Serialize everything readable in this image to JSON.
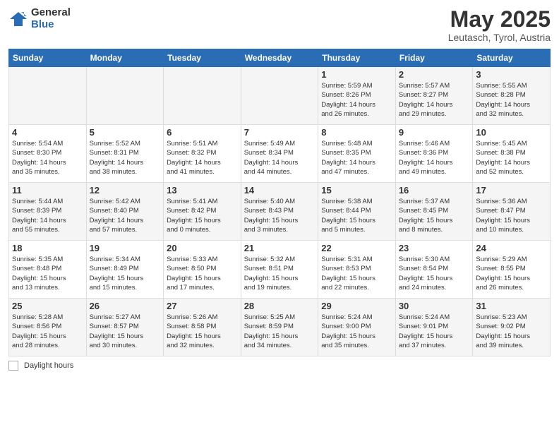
{
  "logo": {
    "general": "General",
    "blue": "Blue"
  },
  "title": "May 2025",
  "subtitle": "Leutasch, Tyrol, Austria",
  "days_header": [
    "Sunday",
    "Monday",
    "Tuesday",
    "Wednesday",
    "Thursday",
    "Friday",
    "Saturday"
  ],
  "weeks": [
    [
      {
        "num": "",
        "info": ""
      },
      {
        "num": "",
        "info": ""
      },
      {
        "num": "",
        "info": ""
      },
      {
        "num": "",
        "info": ""
      },
      {
        "num": "1",
        "info": "Sunrise: 5:59 AM\nSunset: 8:26 PM\nDaylight: 14 hours\nand 26 minutes."
      },
      {
        "num": "2",
        "info": "Sunrise: 5:57 AM\nSunset: 8:27 PM\nDaylight: 14 hours\nand 29 minutes."
      },
      {
        "num": "3",
        "info": "Sunrise: 5:55 AM\nSunset: 8:28 PM\nDaylight: 14 hours\nand 32 minutes."
      }
    ],
    [
      {
        "num": "4",
        "info": "Sunrise: 5:54 AM\nSunset: 8:30 PM\nDaylight: 14 hours\nand 35 minutes."
      },
      {
        "num": "5",
        "info": "Sunrise: 5:52 AM\nSunset: 8:31 PM\nDaylight: 14 hours\nand 38 minutes."
      },
      {
        "num": "6",
        "info": "Sunrise: 5:51 AM\nSunset: 8:32 PM\nDaylight: 14 hours\nand 41 minutes."
      },
      {
        "num": "7",
        "info": "Sunrise: 5:49 AM\nSunset: 8:34 PM\nDaylight: 14 hours\nand 44 minutes."
      },
      {
        "num": "8",
        "info": "Sunrise: 5:48 AM\nSunset: 8:35 PM\nDaylight: 14 hours\nand 47 minutes."
      },
      {
        "num": "9",
        "info": "Sunrise: 5:46 AM\nSunset: 8:36 PM\nDaylight: 14 hours\nand 49 minutes."
      },
      {
        "num": "10",
        "info": "Sunrise: 5:45 AM\nSunset: 8:38 PM\nDaylight: 14 hours\nand 52 minutes."
      }
    ],
    [
      {
        "num": "11",
        "info": "Sunrise: 5:44 AM\nSunset: 8:39 PM\nDaylight: 14 hours\nand 55 minutes."
      },
      {
        "num": "12",
        "info": "Sunrise: 5:42 AM\nSunset: 8:40 PM\nDaylight: 14 hours\nand 57 minutes."
      },
      {
        "num": "13",
        "info": "Sunrise: 5:41 AM\nSunset: 8:42 PM\nDaylight: 15 hours\nand 0 minutes."
      },
      {
        "num": "14",
        "info": "Sunrise: 5:40 AM\nSunset: 8:43 PM\nDaylight: 15 hours\nand 3 minutes."
      },
      {
        "num": "15",
        "info": "Sunrise: 5:38 AM\nSunset: 8:44 PM\nDaylight: 15 hours\nand 5 minutes."
      },
      {
        "num": "16",
        "info": "Sunrise: 5:37 AM\nSunset: 8:45 PM\nDaylight: 15 hours\nand 8 minutes."
      },
      {
        "num": "17",
        "info": "Sunrise: 5:36 AM\nSunset: 8:47 PM\nDaylight: 15 hours\nand 10 minutes."
      }
    ],
    [
      {
        "num": "18",
        "info": "Sunrise: 5:35 AM\nSunset: 8:48 PM\nDaylight: 15 hours\nand 13 minutes."
      },
      {
        "num": "19",
        "info": "Sunrise: 5:34 AM\nSunset: 8:49 PM\nDaylight: 15 hours\nand 15 minutes."
      },
      {
        "num": "20",
        "info": "Sunrise: 5:33 AM\nSunset: 8:50 PM\nDaylight: 15 hours\nand 17 minutes."
      },
      {
        "num": "21",
        "info": "Sunrise: 5:32 AM\nSunset: 8:51 PM\nDaylight: 15 hours\nand 19 minutes."
      },
      {
        "num": "22",
        "info": "Sunrise: 5:31 AM\nSunset: 8:53 PM\nDaylight: 15 hours\nand 22 minutes."
      },
      {
        "num": "23",
        "info": "Sunrise: 5:30 AM\nSunset: 8:54 PM\nDaylight: 15 hours\nand 24 minutes."
      },
      {
        "num": "24",
        "info": "Sunrise: 5:29 AM\nSunset: 8:55 PM\nDaylight: 15 hours\nand 26 minutes."
      }
    ],
    [
      {
        "num": "25",
        "info": "Sunrise: 5:28 AM\nSunset: 8:56 PM\nDaylight: 15 hours\nand 28 minutes."
      },
      {
        "num": "26",
        "info": "Sunrise: 5:27 AM\nSunset: 8:57 PM\nDaylight: 15 hours\nand 30 minutes."
      },
      {
        "num": "27",
        "info": "Sunrise: 5:26 AM\nSunset: 8:58 PM\nDaylight: 15 hours\nand 32 minutes."
      },
      {
        "num": "28",
        "info": "Sunrise: 5:25 AM\nSunset: 8:59 PM\nDaylight: 15 hours\nand 34 minutes."
      },
      {
        "num": "29",
        "info": "Sunrise: 5:24 AM\nSunset: 9:00 PM\nDaylight: 15 hours\nand 35 minutes."
      },
      {
        "num": "30",
        "info": "Sunrise: 5:24 AM\nSunset: 9:01 PM\nDaylight: 15 hours\nand 37 minutes."
      },
      {
        "num": "31",
        "info": "Sunrise: 5:23 AM\nSunset: 9:02 PM\nDaylight: 15 hours\nand 39 minutes."
      }
    ]
  ],
  "footer": {
    "label": "Daylight hours"
  }
}
